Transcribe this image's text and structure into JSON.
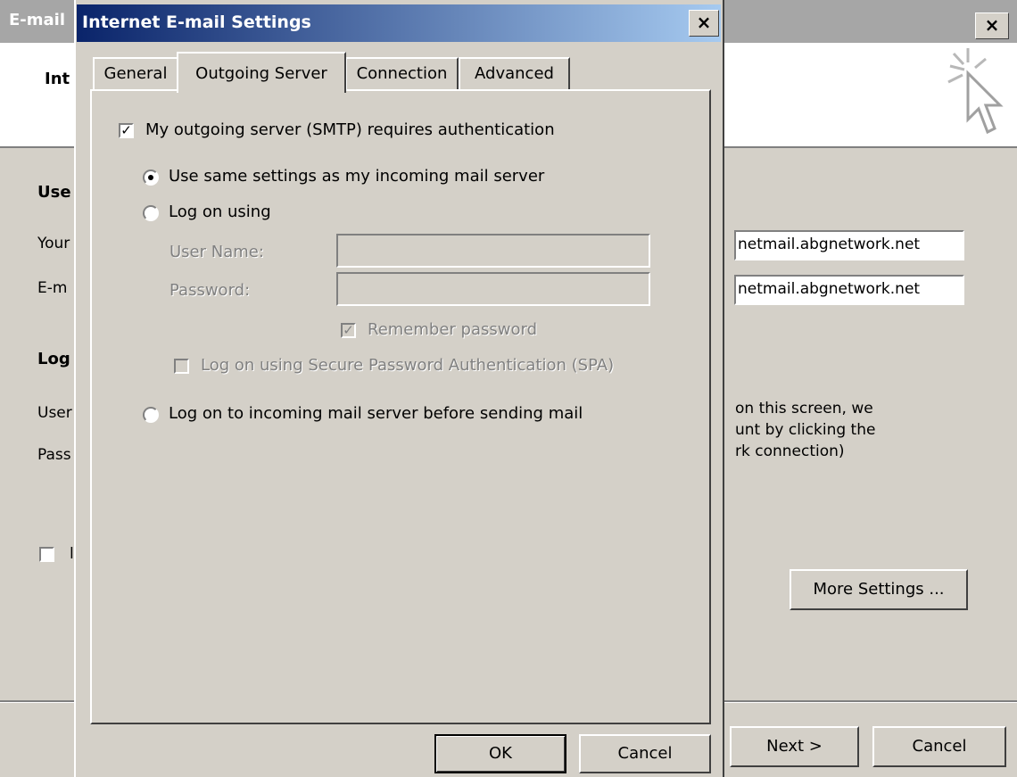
{
  "background_window": {
    "title": "E-mail",
    "close_label": "×",
    "header_title": "Int",
    "section_user_info": "Use",
    "your_name_label": "Your",
    "email_label": "E-m",
    "incoming_server": "netmail.abgnetwork.net",
    "outgoing_server": "netmail.abgnetwork.net",
    "section_logon": "Log",
    "user_label": "User",
    "pass_label": "Pass",
    "test_text_line1": "on this screen, we",
    "test_text_line2": "unt by clicking the",
    "test_text_line3": "rk connection)",
    "checkbox_label_fragment": "l",
    "more_settings_label": "More Settings ...",
    "next_label": "Next >",
    "cancel_label": "Cancel"
  },
  "dialog": {
    "title": "Internet E-mail Settings",
    "close_label": "×",
    "tabs": [
      {
        "label": "General"
      },
      {
        "label": "Outgoing Server"
      },
      {
        "label": "Connection"
      },
      {
        "label": "Advanced"
      }
    ],
    "active_tab": "Outgoing Server",
    "requires_auth": {
      "label": "My outgoing server (SMTP) requires authentication",
      "checked": true
    },
    "radio_same_settings": {
      "label": "Use same settings as my incoming mail server",
      "selected": true
    },
    "radio_log_on_using": {
      "label": "Log on using",
      "selected": false
    },
    "user_name_label": "User Name:",
    "password_label": "Password:",
    "remember_password": {
      "label": "Remember password",
      "checked": true
    },
    "spa": {
      "label": "Log on using Secure Password Authentication (SPA)",
      "checked": false
    },
    "radio_log_on_incoming": {
      "label": "Log on to incoming mail server before sending mail",
      "selected": false
    },
    "ok_label": "OK",
    "cancel_label": "Cancel"
  }
}
